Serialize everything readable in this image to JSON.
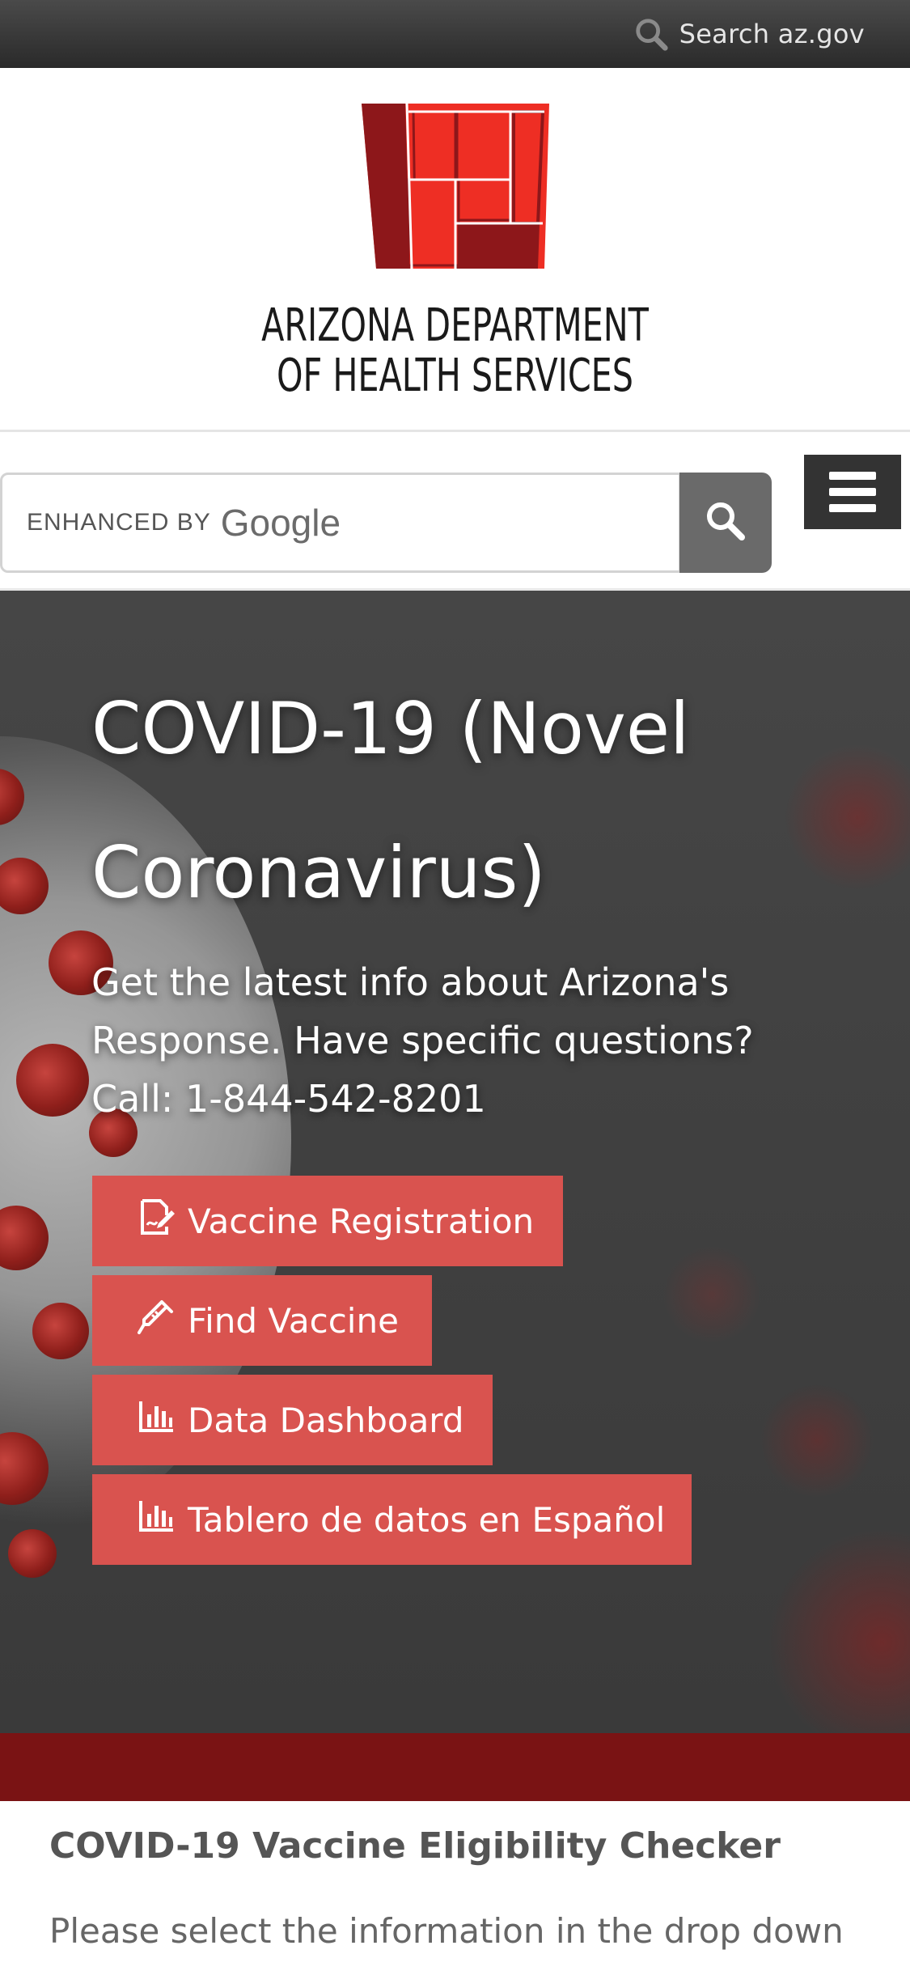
{
  "topbar": {
    "search_label": "Search az.gov",
    "icon": "search-icon"
  },
  "header": {
    "org_name_line1": "ARIZONA DEPARTMENT",
    "org_name_line2": "OF HEALTH SERVICES",
    "logo_colors": {
      "red": "#ee2e24",
      "dark_red": "#8d171a"
    }
  },
  "site_search": {
    "enhanced_by": "ENHANCED BY",
    "google": "Google",
    "button_icon": "search-icon",
    "menu_icon": "hamburger-menu-icon"
  },
  "hero": {
    "title_line1": "COVID-19 (Novel",
    "title_line2": "Coronavirus)",
    "subtitle_line1": "Get the latest info about Arizona's",
    "subtitle_line2": "Response. Have specific questions?",
    "subtitle_line3": "Call: 1-844-542-8201",
    "buttons": [
      {
        "label": "Vaccine Registration",
        "icon": "signature-edit-icon"
      },
      {
        "label": "Find Vaccine",
        "icon": "syringe-icon"
      },
      {
        "label": "Data Dashboard",
        "icon": "bar-chart-icon"
      },
      {
        "label": "Tablero de datos en Español",
        "icon": "bar-chart-icon"
      }
    ],
    "button_color": "#d9534f"
  },
  "eligibility": {
    "title": "COVID-19 Vaccine Eligibility Checker",
    "text": "Please select the information in the drop down"
  }
}
